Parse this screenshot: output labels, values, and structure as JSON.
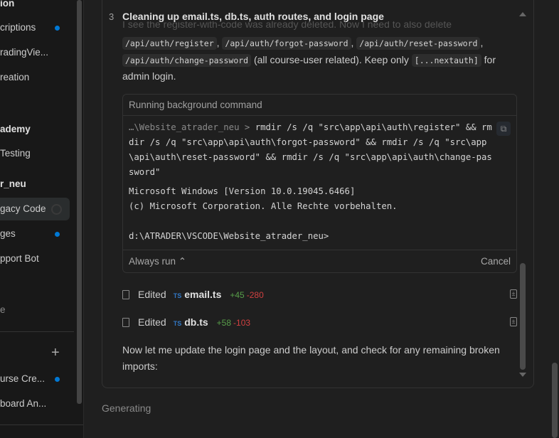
{
  "sidebar": {
    "items": [
      {
        "label": "ion",
        "type": "header"
      },
      {
        "label": "criptions",
        "unread": true
      },
      {
        "label": "radingVie..."
      },
      {
        "label": "reation"
      },
      {
        "label": "ademy",
        "type": "header"
      },
      {
        "label": "Testing"
      },
      {
        "label": "r_neu",
        "type": "header"
      },
      {
        "label": "gacy Code",
        "active": true,
        "loading": true
      },
      {
        "label": "ges",
        "unread": true
      },
      {
        "label": "pport Bot"
      },
      {
        "label": "e"
      },
      {
        "label": "urse Cre...",
        "unread": true
      },
      {
        "label": "board An..."
      }
    ],
    "add_icon": "+"
  },
  "step": {
    "number": "3",
    "title": "Cleaning up email.ts, db.ts, auth routes, and login page",
    "faded_text": "I see the register-with-code was already deleted. Now I need to also delete",
    "code": [
      "/api/auth/register",
      "/api/auth/forgot-password",
      "/api/auth/reset-password",
      "/api/auth/change-password",
      "[...nextauth]"
    ],
    "sep": ",",
    "text1": " (all course-user related). Keep only ",
    "text2": " for admin login."
  },
  "terminal": {
    "title": "Running background command",
    "prefix": "…\\Website_atrader_neu > ",
    "command": "rmdir /s /q \"src\\app\\api\\auth\\register\" && rmdir /s /q \"src\\app\\api\\auth\\forgot-password\" && rmdir /s /q \"src\\app\\api\\auth\\reset-password\" && rmdir /s /q \"src\\app\\api\\auth\\change-password\"",
    "output": "Microsoft Windows [Version 10.0.19045.6466]\n(c) Microsoft Corporation. Alle Rechte vorbehalten.\n\nd:\\ATRADER\\VSCODE\\Website_atrader_neu>",
    "always_run": "Always run ⌃",
    "cancel": "Cancel"
  },
  "edits": [
    {
      "action": "Edited",
      "lang": "TS",
      "file": "email.ts",
      "added": "+45",
      "removed": "-280"
    },
    {
      "action": "Edited",
      "lang": "TS",
      "file": "db.ts",
      "added": "+58",
      "removed": "-103"
    }
  ],
  "closing_text": "Now let me update the login page and the layout, and check for any remaining broken imports:",
  "status": "Generating"
}
